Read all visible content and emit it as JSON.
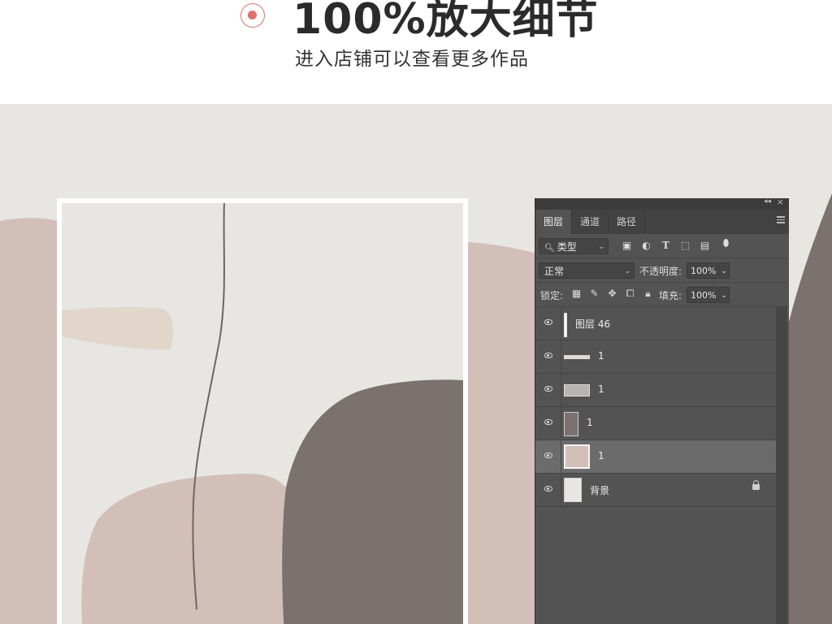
{
  "header": {
    "title": "100%放大细节",
    "subtitle": "进入店铺可以查看更多作品"
  },
  "colors": {
    "accent_red": "#e0706e",
    "canvas_bg": "#e8e6e3",
    "blush": "#d2bfb8",
    "taupe": "#7b716f",
    "sand": "#e2d6cb",
    "panel": "#535353"
  },
  "panel": {
    "tabs": [
      {
        "label": "图层",
        "active": true
      },
      {
        "label": "通道",
        "active": false
      },
      {
        "label": "路径",
        "active": false
      }
    ],
    "filter": {
      "kind_label": "类型",
      "icons": [
        "image-filter-icon",
        "adjustment-filter-icon",
        "type-filter-icon",
        "shape-filter-icon",
        "smart-object-filter-icon",
        "filter-toggle-icon"
      ]
    },
    "blend": {
      "mode": "正常",
      "opacity_label": "不透明度:",
      "opacity_value": "100%"
    },
    "lock": {
      "label": "锁定:",
      "fill_label": "填充:",
      "fill_value": "100%",
      "icons": [
        "lock-transparent-icon",
        "lock-paint-icon",
        "lock-position-icon",
        "lock-artboard-icon",
        "lock-all-icon"
      ]
    },
    "layers": [
      {
        "name": "图层 46",
        "selected": false,
        "locked": false
      },
      {
        "name": "1",
        "selected": false,
        "locked": false
      },
      {
        "name": "1",
        "selected": false,
        "locked": false
      },
      {
        "name": "1",
        "selected": false,
        "locked": false
      },
      {
        "name": "1",
        "selected": true,
        "locked": false
      },
      {
        "name": "背景",
        "selected": false,
        "locked": true
      }
    ]
  }
}
